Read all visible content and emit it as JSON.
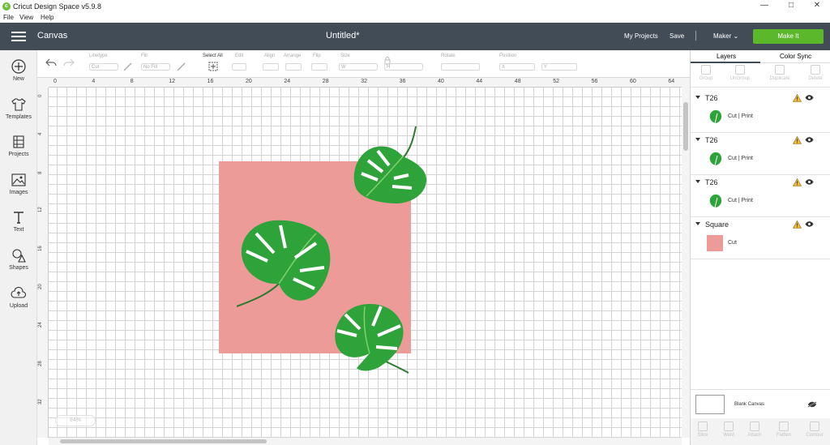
{
  "titlebar": {
    "title": "Cricut Design Space  v5.9.8",
    "app_icon": "cricut-c-icon"
  },
  "menubar": {
    "items": [
      "File",
      "View",
      "Help"
    ]
  },
  "header": {
    "canvas_label": "Canvas",
    "document_title": "Untitled*",
    "my_projects": "My Projects",
    "save": "Save",
    "divider": "|",
    "machine": "Maker",
    "make_it": "Make It",
    "make_it_color": "#5cb82b",
    "bar_color": "#414c57"
  },
  "toolbar": {
    "undo_icon": "undo-icon",
    "redo_icon": "redo-icon",
    "linetype_label": "Linetype",
    "linetype_value": "Cut",
    "fill_label": "Fill",
    "fill_value": "No Fill",
    "select_all": "Select All",
    "edit": "Edit",
    "align": "Align",
    "arrange": "Arrange",
    "flip": "Flip",
    "size": "Size",
    "size_w": "W",
    "size_h": "H",
    "rotate": "Rotate",
    "position": "Position",
    "position_x": "X",
    "position_y": "Y"
  },
  "sidebar": {
    "items": [
      {
        "label": "New",
        "icon": "plus-circle-icon"
      },
      {
        "label": "Templates",
        "icon": "tshirt-icon"
      },
      {
        "label": "Projects",
        "icon": "projects-icon"
      },
      {
        "label": "Images",
        "icon": "image-icon"
      },
      {
        "label": "Text",
        "icon": "text-t-icon"
      },
      {
        "label": "Shapes",
        "icon": "shapes-icon"
      },
      {
        "label": "Upload",
        "icon": "upload-cloud-icon"
      }
    ]
  },
  "ruler": {
    "top": [
      "0",
      "4",
      "8",
      "12",
      "16",
      "20",
      "24",
      "28",
      "32",
      "36",
      "40",
      "44",
      "48",
      "52",
      "56",
      "60",
      "64"
    ],
    "left": [
      "0",
      "4",
      "8",
      "12",
      "16",
      "20",
      "24",
      "28",
      "32"
    ]
  },
  "canvas": {
    "zoom": "84%",
    "square_color": "#ec9b99",
    "leaf_color": "#2ea33a"
  },
  "panel": {
    "tabs": [
      "Layers",
      "Color Sync"
    ],
    "actions": [
      "Group",
      "UnGroup",
      "Duplicate",
      "Delete"
    ],
    "layers": [
      {
        "name": "T26",
        "type": "Cut  |  Print",
        "thumb": "monstera-leaf"
      },
      {
        "name": "T26",
        "type": "Cut  |  Print",
        "thumb": "monstera-leaf"
      },
      {
        "name": "T26",
        "type": "Cut  |  Print",
        "thumb": "monstera-leaf"
      },
      {
        "name": "Square",
        "type": "Cut",
        "thumb": "pink-square"
      }
    ],
    "blank_canvas": "Blank Canvas",
    "bottom_tools": [
      "Slice",
      "Weld",
      "Attach",
      "Flatten",
      "Contour"
    ]
  }
}
